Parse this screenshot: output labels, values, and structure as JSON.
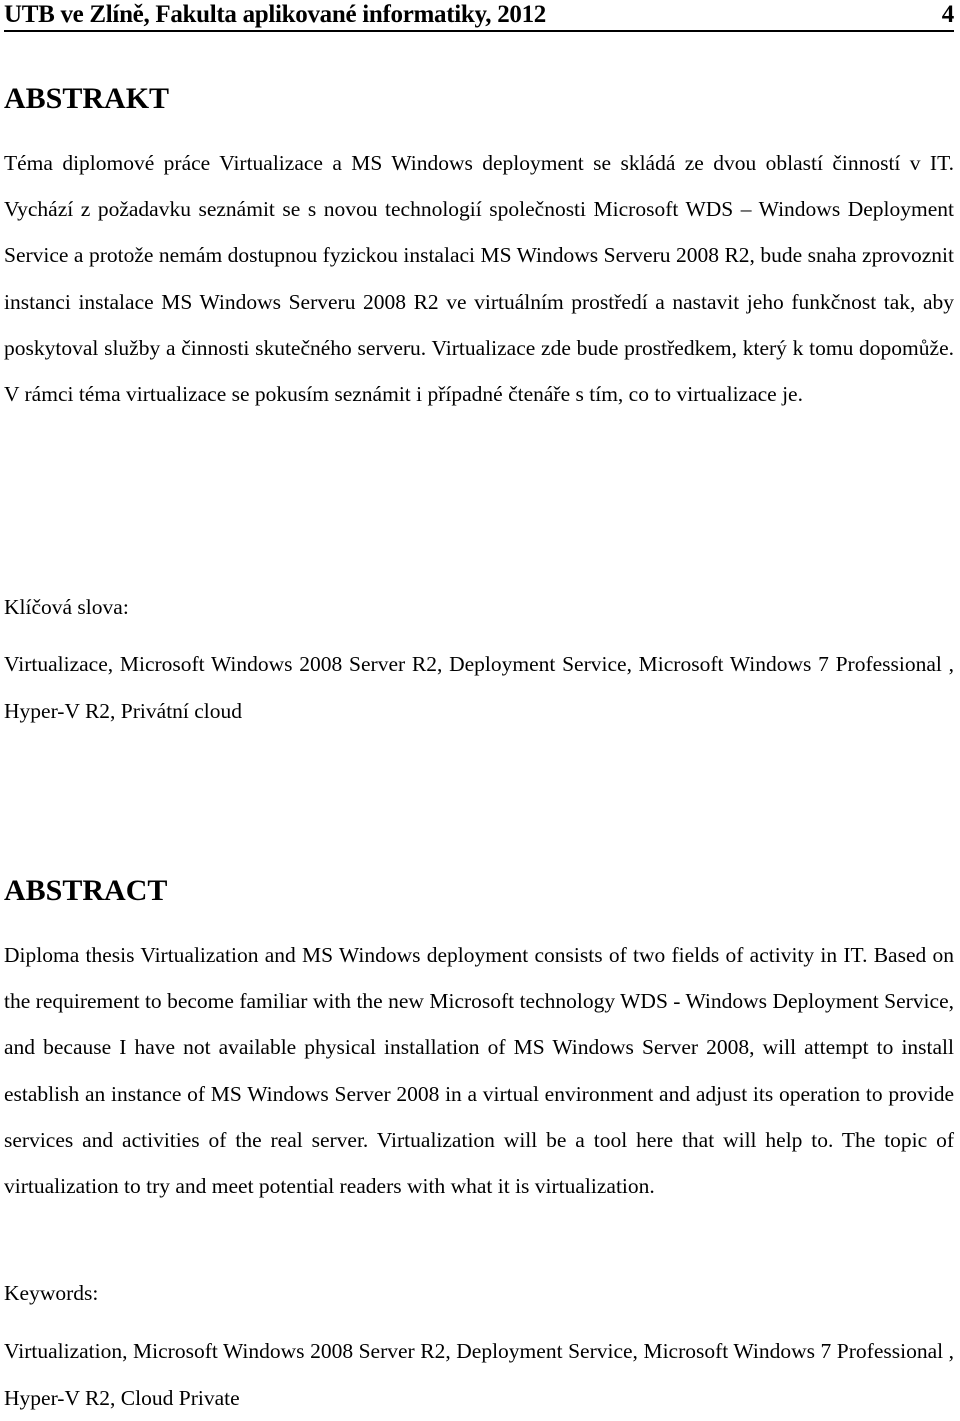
{
  "header": {
    "title": "UTB ve Zlíně, Fakulta aplikované informatiky, 2012",
    "page_number": "4"
  },
  "abstrakt": {
    "heading": "ABSTRAKT",
    "body": "Téma diplomové práce Virtualizace a MS Windows deployment se skládá ze dvou oblastí činností v IT. Vychází z požadavku seznámit se s novou technologií společnosti Microsoft WDS – Windows Deployment Service a protože nemám dostupnou fyzickou instalaci MS Windows Serveru 2008 R2, bude snaha zprovoznit instanci instalace MS Windows Serveru 2008 R2 ve virtuálním prostředí a nastavit jeho funkčnost tak, aby poskytoval služby a činnosti skutečného serveru. Virtualizace zde bude prostředkem, který k tomu dopomůže. V rámci téma virtualizace se pokusím seznámit i případné čtenáře s tím, co to virtualizace je.",
    "keywords_label": "Klíčová slova:",
    "keywords": "Virtualizace, Microsoft Windows 2008 Server R2, Deployment Service, Microsoft Windows 7 Professional , Hyper-V R2, Privátní cloud"
  },
  "abstract": {
    "heading": "ABSTRACT",
    "body": "Diploma thesis Virtualization and MS Windows deployment consists of two fields of activity in IT. Based on the requirement to become familiar with the new Microsoft technology WDS - Windows Deployment Service, and because I have not available physical installation of MS Windows Server 2008, will attempt to install establish an instance of MS Windows Server 2008 in a virtual environment and adjust its operation to provide services and activities of the real server. Virtualization will be a tool here that will help to. The topic of virtualization to try and meet potential readers with what it is virtualization.",
    "keywords_label": "Keywords:",
    "keywords": "Virtualization, Microsoft Windows 2008 Server R2, Deployment Service, Microsoft Windows 7 Professional , Hyper-V R2, Cloud Private"
  }
}
